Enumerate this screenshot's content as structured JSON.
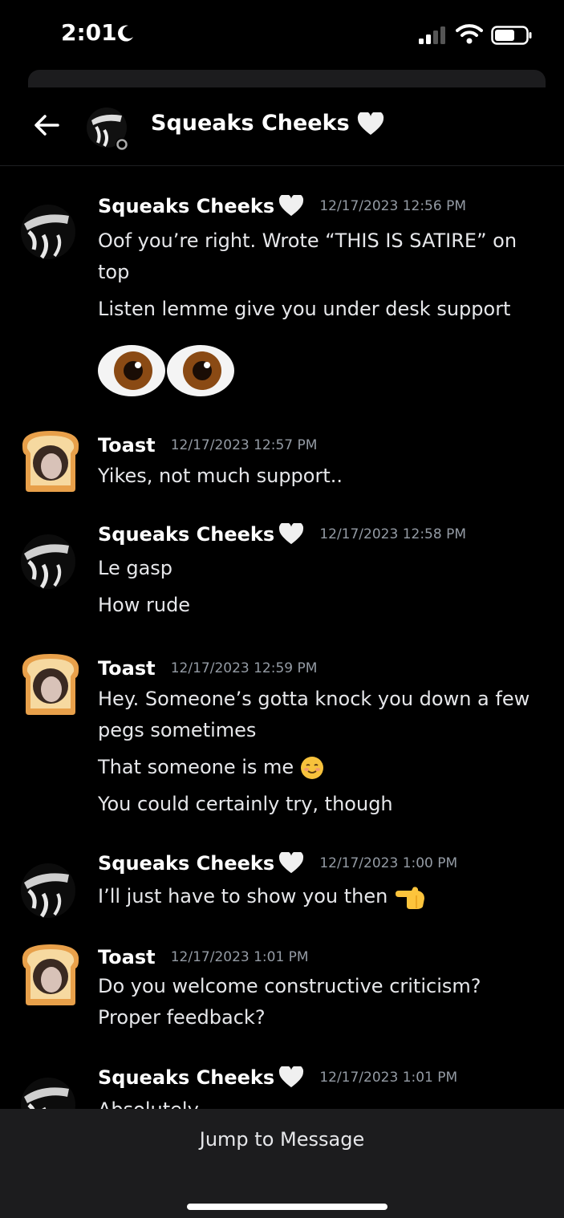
{
  "status": {
    "time": "2:01"
  },
  "header": {
    "title": "Squeaks Cheeks"
  },
  "messages": [
    {
      "author": "Squeaks Cheeks",
      "timestamp": "12/17/2023 12:56 PM",
      "lines": [
        "Oof you’re right. Wrote “THIS IS SATIRE” on",
        "top",
        "Listen lemme give you under desk support"
      ]
    },
    {
      "author": "Toast",
      "timestamp": "12/17/2023 12:57 PM",
      "lines": [
        "Yikes, not much support.."
      ]
    },
    {
      "author": "Squeaks Cheeks",
      "timestamp": "12/17/2023 12:58 PM",
      "lines": [
        "Le gasp",
        "How rude"
      ]
    },
    {
      "author": "Toast",
      "timestamp": "12/17/2023 12:59 PM",
      "lines": [
        "Hey. Someone’s gotta knock you down a few",
        "pegs sometimes",
        "That someone is me",
        "You could certainly try, though"
      ]
    },
    {
      "author": "Squeaks Cheeks",
      "timestamp": "12/17/2023 1:00 PM",
      "lines": [
        "I’ll just have to show you then"
      ]
    },
    {
      "author": "Toast",
      "timestamp": "12/17/2023 1:01 PM",
      "lines": [
        "Do you welcome constructive criticism?",
        "Proper feedback?"
      ]
    },
    {
      "author": "Squeaks Cheeks",
      "timestamp": "12/17/2023 1:01 PM",
      "lines": [
        "Absolutely"
      ]
    }
  ],
  "emojis": {
    "eyes": "eyes-emoji",
    "smiling": "smiling-blush-emoji",
    "pointing": "pointing-left-emoji"
  },
  "footer": {
    "jump_label": "Jump to Message"
  },
  "colors": {
    "background": "#000000",
    "timestamp": "#949ba4",
    "footer": "#1c1c1e"
  }
}
